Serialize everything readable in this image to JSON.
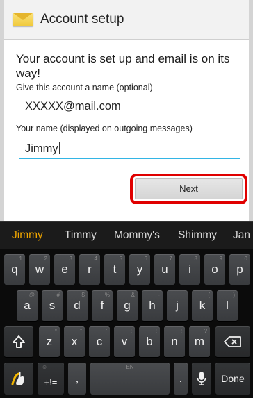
{
  "app": {
    "title": "Account setup",
    "icon": "email-envelope-icon"
  },
  "form": {
    "headline": "Your account is set up and email is on its way!",
    "account_name_label": "Give this account a name (optional)",
    "account_name_value": "XXXXX@mail.com",
    "your_name_label": "Your name (displayed on outgoing messages)",
    "your_name_value": "Jimmy",
    "next_label": "Next",
    "highlight_color": "#e00000"
  },
  "suggestions": [
    {
      "text": "Jimmy",
      "color": "#f0a500"
    },
    {
      "text": "Timmy"
    },
    {
      "text": "Mommy's"
    },
    {
      "text": "Shimmy"
    },
    {
      "text": "Jan"
    }
  ],
  "keyboard": {
    "row1": [
      {
        "k": "q",
        "h": "1"
      },
      {
        "k": "w",
        "h": "2"
      },
      {
        "k": "e",
        "h": "3"
      },
      {
        "k": "r",
        "h": "4"
      },
      {
        "k": "t",
        "h": "5"
      },
      {
        "k": "y",
        "h": "6"
      },
      {
        "k": "u",
        "h": "7"
      },
      {
        "k": "i",
        "h": "8"
      },
      {
        "k": "o",
        "h": "9"
      },
      {
        "k": "p",
        "h": "0"
      }
    ],
    "row2": [
      {
        "k": "a",
        "h": "@"
      },
      {
        "k": "s",
        "h": "#"
      },
      {
        "k": "d",
        "h": "$"
      },
      {
        "k": "f",
        "h": "%"
      },
      {
        "k": "g",
        "h": "&"
      },
      {
        "k": "h",
        "h": "-"
      },
      {
        "k": "j",
        "h": "+"
      },
      {
        "k": "k",
        "h": "("
      },
      {
        "k": "l",
        "h": ")"
      }
    ],
    "row3": [
      {
        "k": "z",
        "h": "*"
      },
      {
        "k": "x",
        "h": "\""
      },
      {
        "k": "c",
        "h": "'"
      },
      {
        "k": "v",
        "h": ":"
      },
      {
        "k": "b",
        "h": ";"
      },
      {
        "k": "n",
        "h": "!"
      },
      {
        "k": "m",
        "h": "?"
      }
    ],
    "shift_icon": "shift-icon",
    "backspace_icon": "backspace-icon",
    "swype_icon": "swype-icon",
    "symbols_label": "+!=",
    "symbols_hint": "☺",
    "comma_label": ",",
    "space_hint": "EN",
    "period_label": ".",
    "mic_icon": "microphone-icon",
    "done_label": "Done"
  }
}
